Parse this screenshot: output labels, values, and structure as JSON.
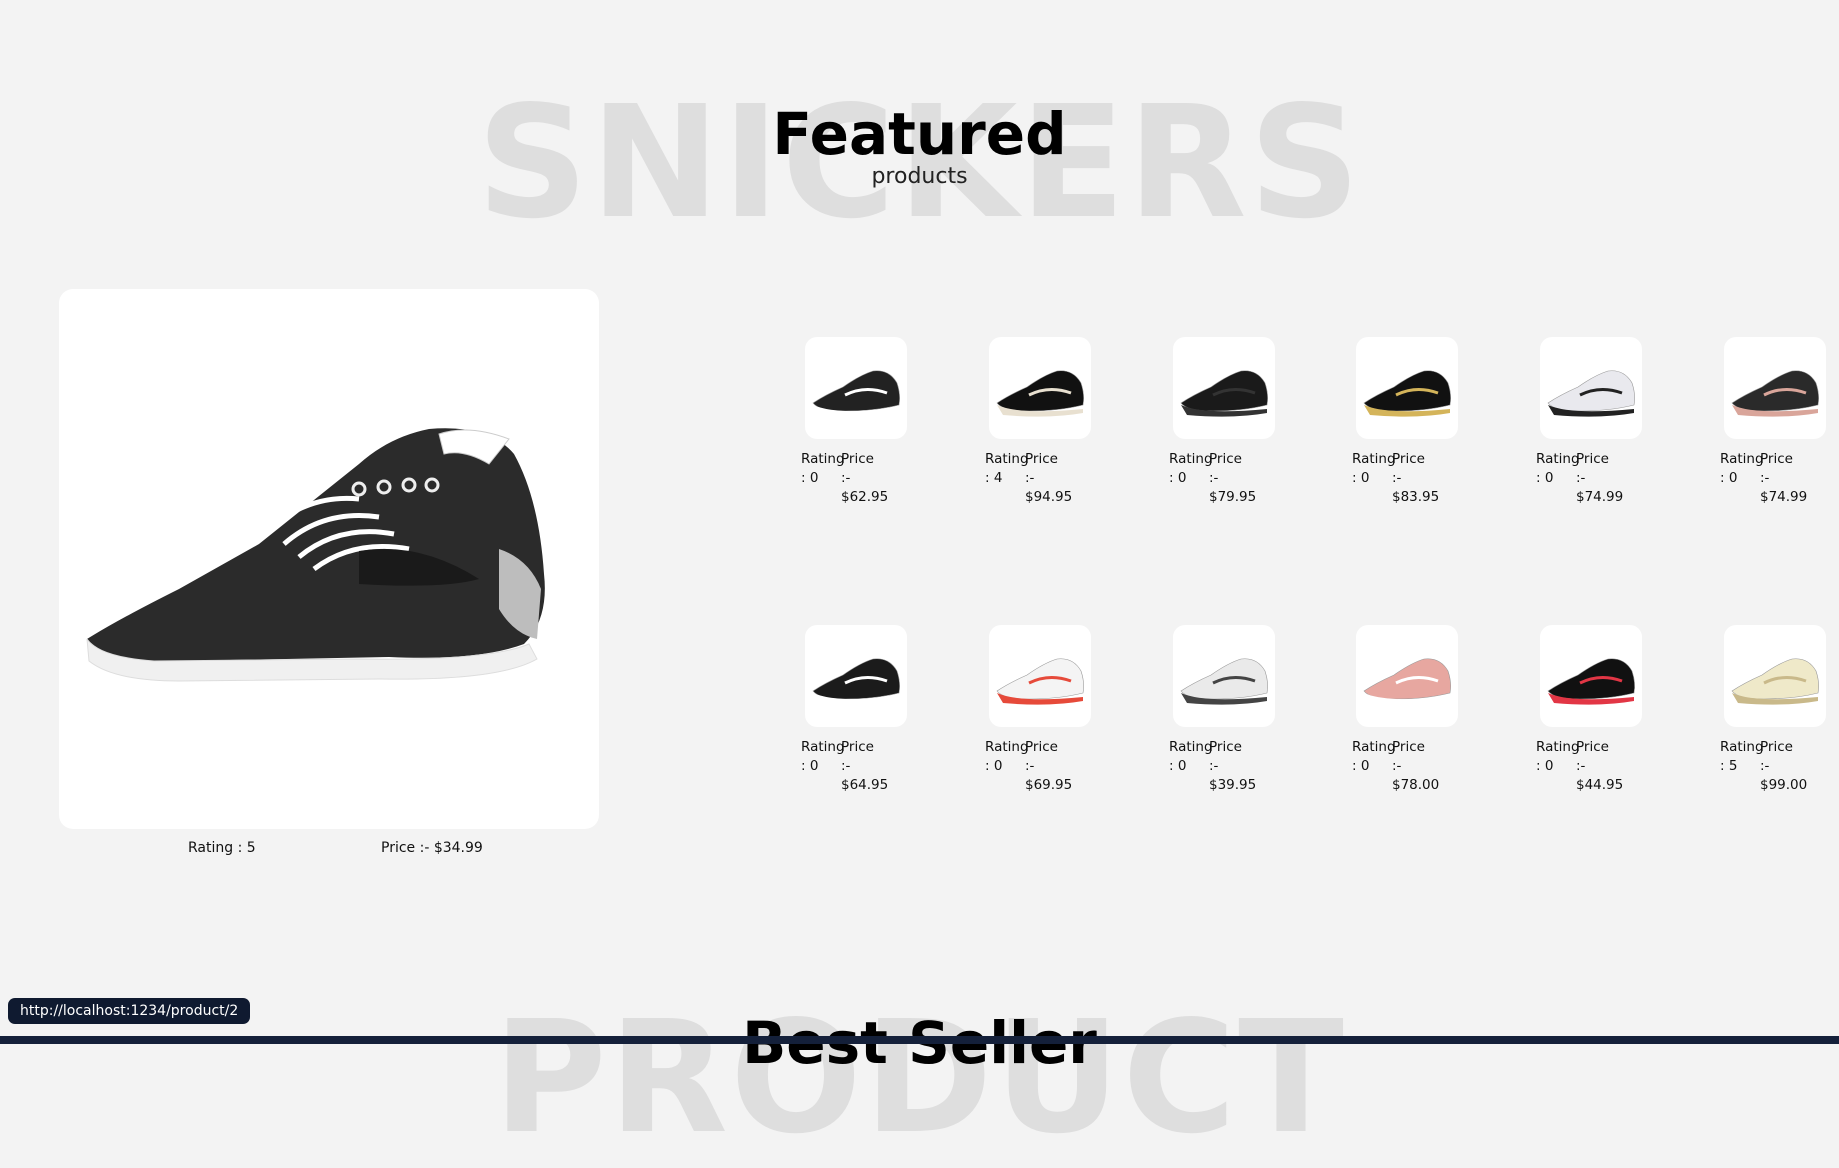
{
  "background_word_top": "SNICKERS",
  "background_word_bottom": "PRODUCT",
  "featured": {
    "title": "Featured",
    "subtitle": "products"
  },
  "big_product": {
    "rating": "Rating : 5",
    "price": "Price :- $34.99"
  },
  "products": [
    {
      "rating_label": "Rating",
      "rating_value": ": 0",
      "price_label": "Price",
      "price_sep": ":-",
      "price": "$62.95"
    },
    {
      "rating_label": "Rating",
      "rating_value": ": 4",
      "price_label": "Price",
      "price_sep": ":-",
      "price": "$94.95"
    },
    {
      "rating_label": "Rating",
      "rating_value": ": 0",
      "price_label": "Price",
      "price_sep": ":-",
      "price": "$79.95"
    },
    {
      "rating_label": "Rating",
      "rating_value": ": 0",
      "price_label": "Price",
      "price_sep": ":-",
      "price": "$83.95"
    },
    {
      "rating_label": "Rating",
      "rating_value": ": 0",
      "price_label": "Price",
      "price_sep": ":-",
      "price": "$74.99"
    },
    {
      "rating_label": "Rating",
      "rating_value": ": 0",
      "price_label": "Price",
      "price_sep": ":-",
      "price": "$74.99"
    },
    {
      "rating_label": "Rating",
      "rating_value": ": 0",
      "price_label": "Price",
      "price_sep": ":-",
      "price": "$64.95"
    },
    {
      "rating_label": "Rating",
      "rating_value": ": 0",
      "price_label": "Price",
      "price_sep": ":-",
      "price": "$69.95"
    },
    {
      "rating_label": "Rating",
      "rating_value": ": 0",
      "price_label": "Price",
      "price_sep": ":-",
      "price": "$39.95"
    },
    {
      "rating_label": "Rating",
      "rating_value": ": 0",
      "price_label": "Price",
      "price_sep": ":-",
      "price": "$78.00"
    },
    {
      "rating_label": "Rating",
      "rating_value": ": 0",
      "price_label": "Price",
      "price_sep": ":-",
      "price": "$44.95"
    },
    {
      "rating_label": "Rating",
      "rating_value": ": 5",
      "price_label": "Price",
      "price_sep": ":-",
      "price": "$99.00"
    }
  ],
  "best_seller": {
    "title": "Best Seller"
  },
  "status_url": "http://localhost:1234/product/2",
  "colors": {
    "page_bg": "#f3f3f3",
    "card_bg": "#ffffff",
    "status_bg": "#0f1a30"
  }
}
